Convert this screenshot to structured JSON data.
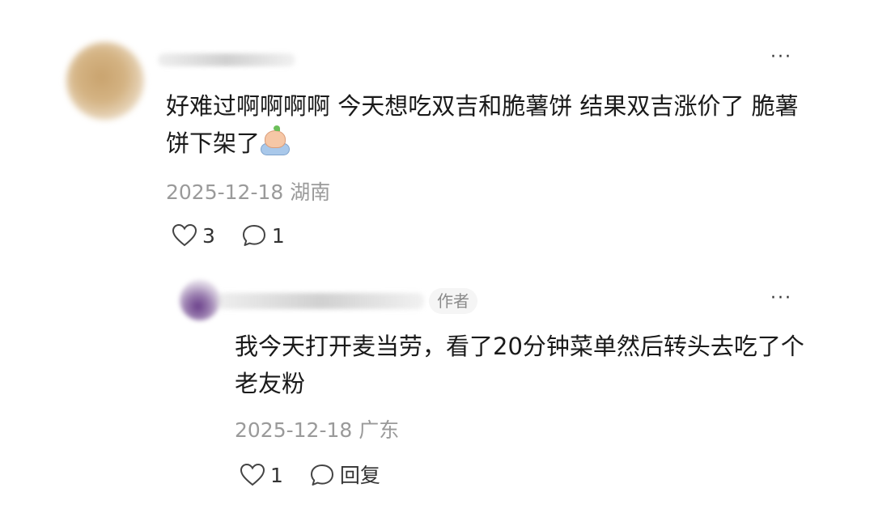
{
  "main_comment": {
    "text": "好难过啊啊啊啊 今天想吃双吉和脆薯饼 结果双吉涨价了 脆薯饼下架了",
    "emoji": "crying-emoji",
    "date": "2025-12-18",
    "location": "湖南",
    "likes": "3",
    "replies": "1",
    "more": "···"
  },
  "reply": {
    "badge": "作者",
    "text": "我今天打开麦当劳，看了20分钟菜单然后转头去吃了个老友粉",
    "date": "2025-12-18",
    "location": "广东",
    "likes": "1",
    "reply_label": "回复",
    "more": "···"
  }
}
